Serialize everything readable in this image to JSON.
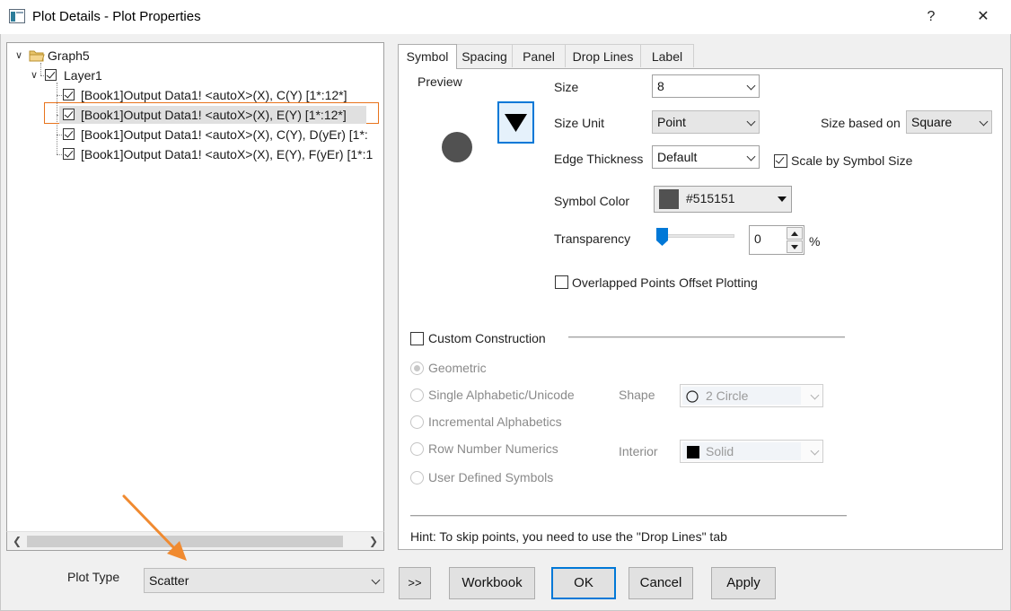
{
  "window": {
    "title": "Plot Details - Plot Properties",
    "help_label": "?",
    "close_label": "✕"
  },
  "tree": {
    "root": "Graph5",
    "layer": "Layer1",
    "items": [
      {
        "label": "[Book1]Output Data1! <autoX>(X), C(Y) [1*:12*]",
        "checked": true,
        "selected": false
      },
      {
        "label": "[Book1]Output Data1! <autoX>(X), E(Y) [1*:12*]",
        "checked": true,
        "selected": true
      },
      {
        "label": "[Book1]Output Data1! <autoX>(X), C(Y), D(yEr) [1*:",
        "checked": true,
        "selected": false
      },
      {
        "label": "[Book1]Output Data1! <autoX>(X), E(Y), F(yEr) [1*:1",
        "checked": true,
        "selected": false
      }
    ]
  },
  "tabs": [
    "Symbol",
    "Spacing",
    "Panel",
    "Drop Lines",
    "Label"
  ],
  "active_tab": "Symbol",
  "symbol": {
    "preview_label": "Preview",
    "size_label": "Size",
    "size_value": "8",
    "size_unit_label": "Size Unit",
    "size_unit_value": "Point",
    "size_based_on_label": "Size based on",
    "size_based_on_value": "Square",
    "edge_thickness_label": "Edge Thickness",
    "edge_thickness_value": "Default",
    "scale_by_symbol_size_label": "Scale by Symbol Size",
    "scale_by_symbol_size_checked": true,
    "symbol_color_label": "Symbol Color",
    "symbol_color_value": "#515151",
    "transparency_label": "Transparency",
    "transparency_value": "0",
    "transparency_unit": "%",
    "overlapped_label": "Overlapped Points Offset Plotting",
    "overlapped_checked": false
  },
  "custom": {
    "label": "Custom Construction",
    "checked": false,
    "options": [
      "Geometric",
      "Single Alphabetic/Unicode",
      "Incremental Alphabetics",
      "Row Number Numerics",
      "User Defined Symbols"
    ],
    "selected_option": "Geometric",
    "shape_label": "Shape",
    "shape_value": "2 Circle",
    "interior_label": "Interior",
    "interior_value": "Solid"
  },
  "hint": "Hint: To skip points, you need to use the \"Drop Lines\" tab",
  "footer": {
    "plot_type_label": "Plot Type",
    "plot_type_value": "Scatter",
    "expand_label": ">>",
    "workbook_label": "Workbook",
    "ok_label": "OK",
    "cancel_label": "Cancel",
    "apply_label": "Apply"
  },
  "colors": {
    "symbol_color": "#515151",
    "accent": "#0078d7",
    "selection_outline": "#e8731c",
    "annotation_arrow": "#f08a30"
  }
}
